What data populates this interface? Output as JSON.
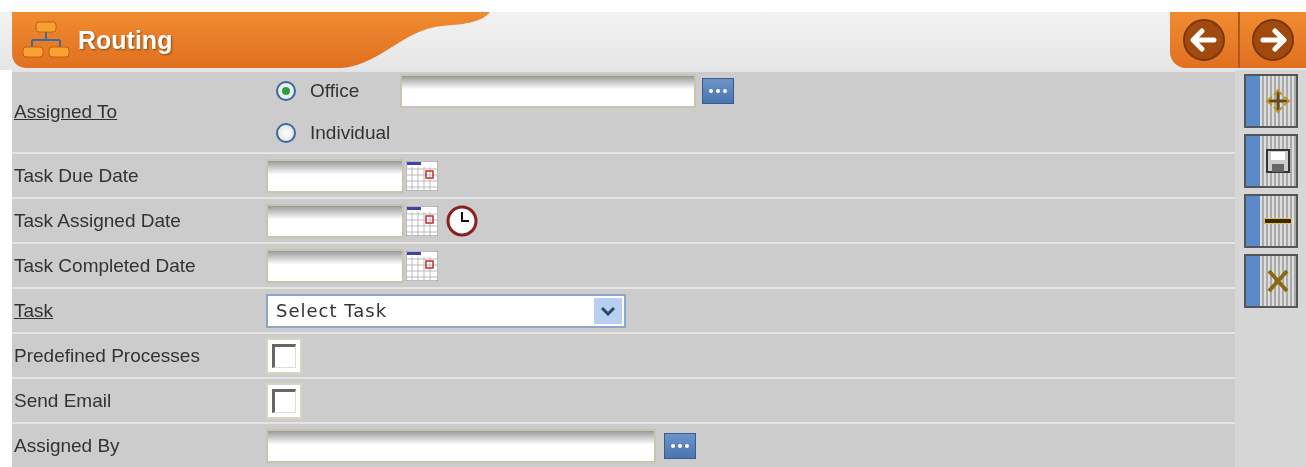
{
  "header": {
    "title": "Routing"
  },
  "fields": [
    {
      "kind": "radio",
      "label": "Assigned To",
      "underlined": true,
      "options": [
        {
          "label": "Office",
          "selected": true,
          "lookup": true
        },
        {
          "label": "Individual",
          "selected": false,
          "lookup": false
        }
      ]
    },
    {
      "kind": "date",
      "label": "Task Due Date",
      "underlined": false,
      "time_picker": false
    },
    {
      "kind": "date",
      "label": "Task Assigned Date",
      "underlined": false,
      "time_picker": true
    },
    {
      "kind": "date",
      "label": "Task Completed Date",
      "underlined": false,
      "time_picker": false
    },
    {
      "kind": "select",
      "label": "Task",
      "underlined": true,
      "value": "Select Task"
    },
    {
      "kind": "checkbox",
      "label": "Predefined Processes",
      "underlined": false,
      "checked": false
    },
    {
      "kind": "checkbox",
      "label": "Send Email",
      "underlined": false,
      "checked": false
    },
    {
      "kind": "lookup",
      "label": "Assigned By",
      "underlined": false
    }
  ]
}
